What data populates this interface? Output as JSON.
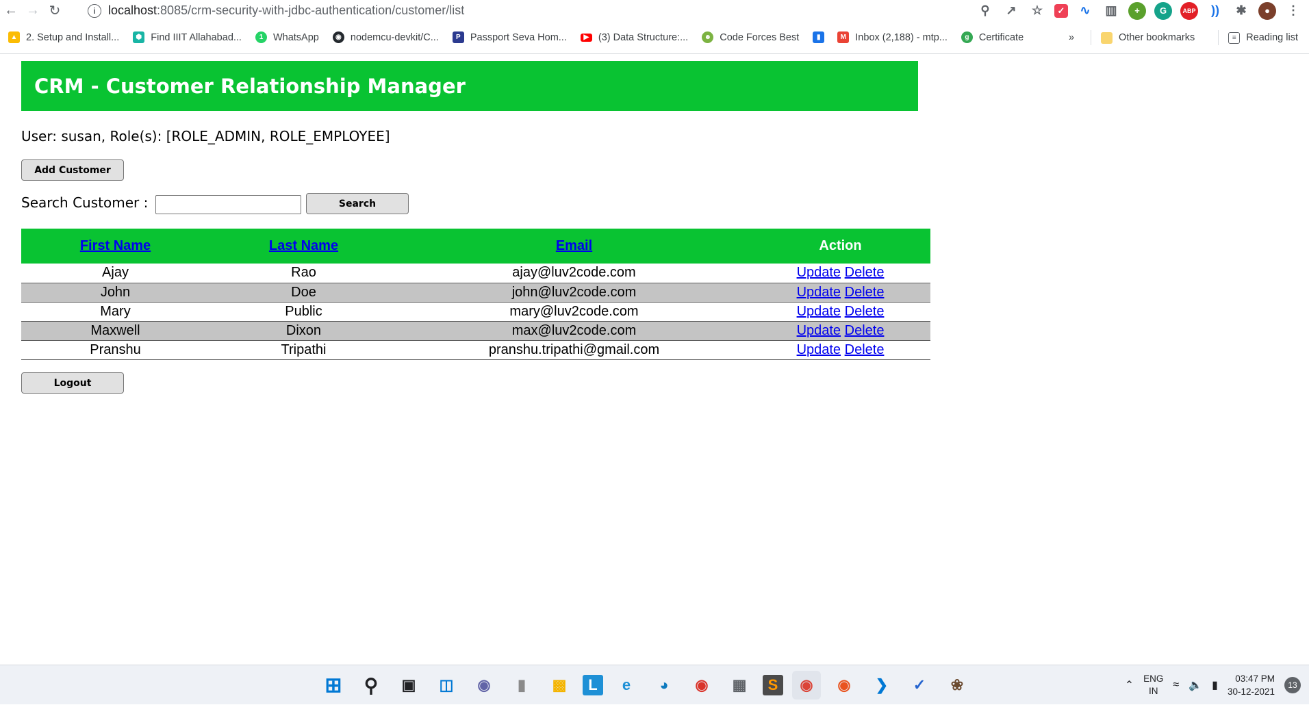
{
  "browser": {
    "url_host": "localhost",
    "url_rest": ":8085/crm-security-with-jdbc-authentication/customer/list",
    "bookmarks": [
      {
        "label": "2. Setup and Install...",
        "color": "#fbbc04"
      },
      {
        "label": "Find IIIT Allahabad...",
        "color": "#19b5a5"
      },
      {
        "label": "WhatsApp",
        "color": "#25d366"
      },
      {
        "label": "nodemcu-devkit/C...",
        "color": "#24292e"
      },
      {
        "label": "Passport Seva Hom...",
        "color": "#2b3a8f"
      },
      {
        "label": "(3) Data Structure:...",
        "color": "#ff0000"
      },
      {
        "label": "Code Forces Best",
        "color": "#7cb342"
      },
      {
        "label": "",
        "color": "#1a73e8"
      },
      {
        "label": "Inbox (2,188) - mtp...",
        "color": "#ea4335"
      },
      {
        "label": "Certificate",
        "color": "#34a853"
      }
    ],
    "more": "»",
    "other_bookmarks": "Other bookmarks",
    "reading_list": "Reading list"
  },
  "header": {
    "title": "CRM - Customer Relationship Manager"
  },
  "user_line": "User: susan, Role(s): [ROLE_ADMIN, ROLE_EMPLOYEE]",
  "buttons": {
    "add_customer": "Add Customer",
    "search": "Search",
    "logout": "Logout"
  },
  "search": {
    "label": "Search Customer :",
    "value": ""
  },
  "table": {
    "headers": {
      "first_name": "First Name",
      "last_name": "Last Name",
      "email": "Email",
      "action": "Action"
    },
    "action_links": {
      "update": "Update",
      "delete": "Delete"
    },
    "rows": [
      {
        "first": "Ajay",
        "last": "Rao",
        "email": "ajay@luv2code.com"
      },
      {
        "first": "John",
        "last": "Doe",
        "email": "john@luv2code.com"
      },
      {
        "first": "Mary",
        "last": "Public",
        "email": "mary@luv2code.com"
      },
      {
        "first": "Maxwell",
        "last": "Dixon",
        "email": "max@luv2code.com"
      },
      {
        "first": "Pranshu",
        "last": "Tripathi",
        "email": "pranshu.tripathi@gmail.com"
      }
    ]
  },
  "taskbar": {
    "lang": "ENG",
    "region": "IN",
    "time": "03:47 PM",
    "date": "30-12-2021",
    "notifications": "13"
  },
  "colors": {
    "header_green": "#09c332",
    "alt_row": "#c4c4c4",
    "link": "#0000ee"
  }
}
